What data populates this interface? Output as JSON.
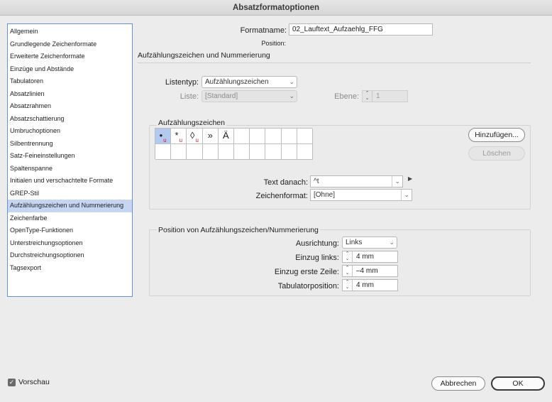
{
  "window": {
    "title": "Absatzformatoptionen"
  },
  "sidebar": {
    "items": [
      {
        "label": "Allgemein"
      },
      {
        "label": "Grundlegende Zeichenformate"
      },
      {
        "label": "Erweiterte Zeichenformate"
      },
      {
        "label": "Einzüge und Abstände"
      },
      {
        "label": "Tabulatoren"
      },
      {
        "label": "Absatzlinien"
      },
      {
        "label": "Absatzrahmen"
      },
      {
        "label": "Absatzschattierung"
      },
      {
        "label": "Umbruchoptionen"
      },
      {
        "label": "Silbentrennung"
      },
      {
        "label": "Satz-Feineinstellungen"
      },
      {
        "label": "Spaltenspanne"
      },
      {
        "label": "Initialen und verschachtelte Formate"
      },
      {
        "label": "GREP-Stil"
      },
      {
        "label": "Aufzählungszeichen und Nummerierung"
      },
      {
        "label": "Zeichenfarbe"
      },
      {
        "label": "OpenType-Funktionen"
      },
      {
        "label": "Unterstreichungsoptionen"
      },
      {
        "label": "Durchstreichungsoptionen"
      },
      {
        "label": "Tagsexport"
      }
    ],
    "selected_index": 14
  },
  "header": {
    "formatname_label": "Formatname:",
    "formatname_value": "02_Lauftext_Aufzaehlg_FFG",
    "position_label": "Position:",
    "section_title": "Aufzählungszeichen und Nummerierung"
  },
  "list": {
    "listentyp_label": "Listentyp:",
    "listentyp_value": "Aufzählungszeichen",
    "liste_label": "Liste:",
    "liste_value": "[Standard]",
    "ebene_label": "Ebene:",
    "ebene_value": "1"
  },
  "bullets": {
    "group_title": "Aufzählungszeichen",
    "glyphs": [
      {
        "char": "•",
        "sub": "u"
      },
      {
        "char": "*",
        "sub": "u"
      },
      {
        "char": "◊",
        "sub": "u"
      },
      {
        "char": "»",
        "sub": ""
      },
      {
        "char": "Ä",
        "sub": ""
      }
    ],
    "add_button": "Hinzufügen...",
    "delete_button": "Löschen",
    "text_after_label": "Text danach:",
    "text_after_value": "^t",
    "char_format_label": "Zeichenformat:",
    "char_format_value": "[Ohne]"
  },
  "position": {
    "group_title": "Position von Aufzählungszeichen/Nummerierung",
    "alignment_label": "Ausrichtung:",
    "alignment_value": "Links",
    "indent_left_label": "Einzug links:",
    "indent_left_value": "4 mm",
    "indent_first_label": "Einzug erste Zeile:",
    "indent_first_value": "–4 mm",
    "tab_pos_label": "Tabulatorposition:",
    "tab_pos_value": "4 mm"
  },
  "footer": {
    "preview_label": "Vorschau",
    "preview_checked": true,
    "cancel_button": "Abbrechen",
    "ok_button": "OK"
  }
}
